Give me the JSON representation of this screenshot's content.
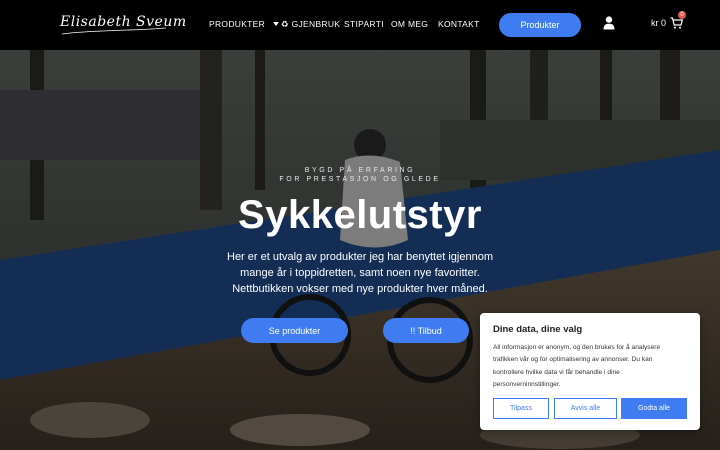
{
  "header": {
    "logo_text": "Elisabeth Sveum",
    "nav": [
      {
        "label": "PRODUKTER"
      },
      {
        "label": "♻ GJENBRUK"
      },
      {
        "label": "STIPARTI"
      },
      {
        "label": "OM MEG"
      },
      {
        "label": "KONTAKT"
      }
    ],
    "cta_label": "Produkter",
    "cart_label": "kr 0",
    "cart_count": "0"
  },
  "hero": {
    "kicker_line1": "BYGD PÅ ERFARING",
    "kicker_line2": "FOR PRESTASJON OG GLEDE",
    "title": "Sykkelutstyr",
    "desc_line1": "Her er et utvalg av produkter jeg har benyttet igjennom",
    "desc_line2": "mange år i toppidretten, samt noen nye favoritter.",
    "desc_line3": "Nettbutikken vokser med nye produkter hver måned.",
    "btn_products": "Se produkter",
    "btn_offers": "!! Tilbud"
  },
  "cookie": {
    "title": "Dine data, dine valg",
    "line1": "All informasjon er anonym, og den brukes for å analysere",
    "line2": "trafikken vår og for optimalisering av annonser. Du kan",
    "line3": "kontrollere hvilke data vi får behandle i dine",
    "line4": "personverninnstillinger.",
    "btn_customize": "Tilpass",
    "btn_reject": "Avvis alle",
    "btn_accept": "Godta alle"
  },
  "colors": {
    "accent": "#3f7cf2",
    "header_bg": "#000000",
    "badge": "#e2574c"
  },
  "icons": [
    "user-icon",
    "cart-icon",
    "chevron-down-icon",
    "recycle-icon"
  ]
}
